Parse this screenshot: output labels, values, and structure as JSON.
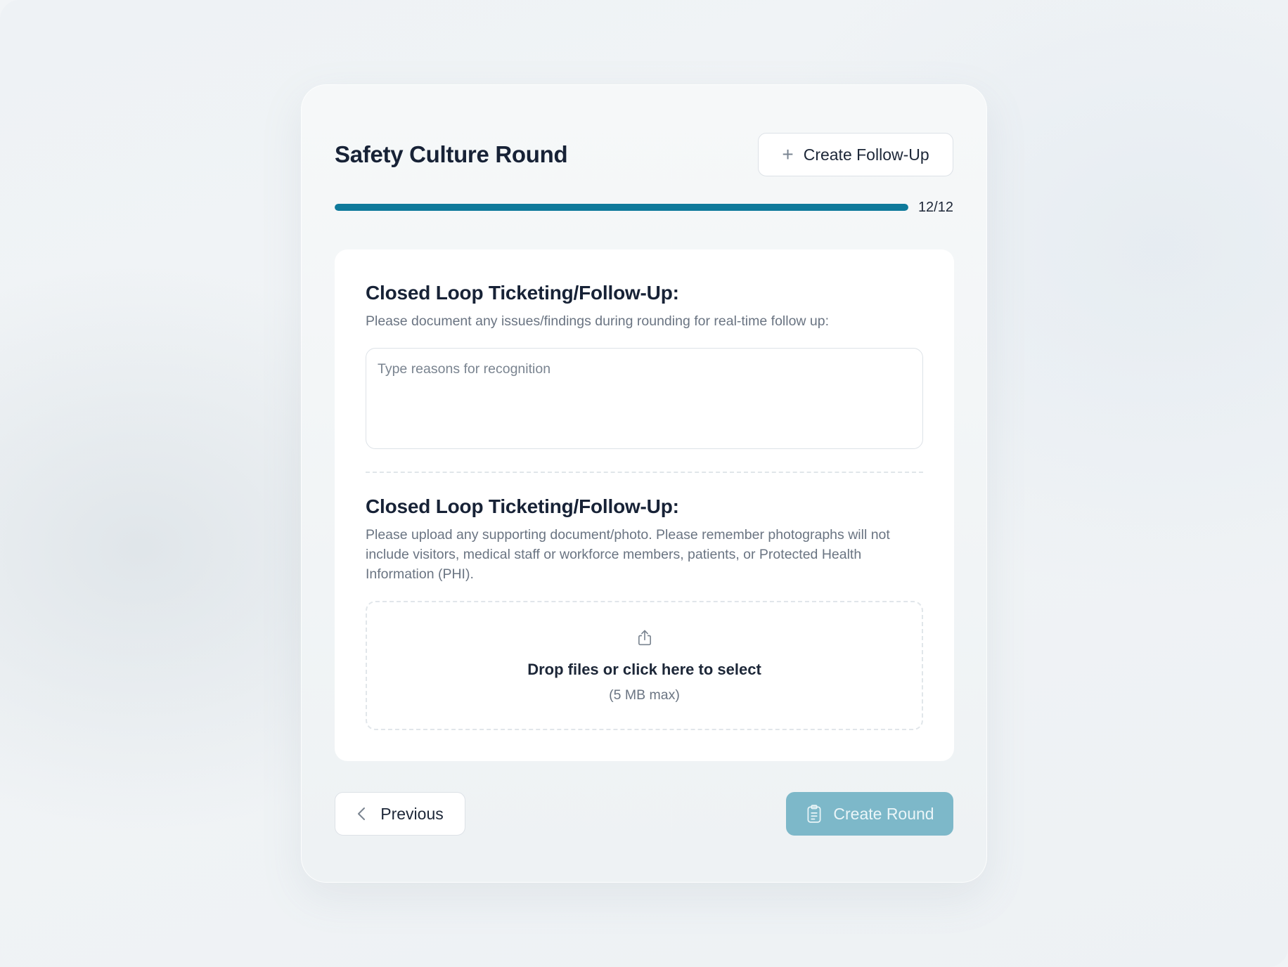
{
  "header": {
    "title": "Safety Culture Round",
    "follow_up_button": "Create Follow-Up"
  },
  "progress": {
    "current": 12,
    "total": 12,
    "fraction": 1.0,
    "label": "12/12",
    "color": "#0f7a9b"
  },
  "section_one": {
    "title": "Closed Loop Ticketing/Follow-Up:",
    "description": "Please document any issues/findings during rounding for real-time follow up:",
    "input_placeholder": "Type reasons for recognition",
    "input_value": ""
  },
  "section_two": {
    "title": "Closed Loop Ticketing/Follow-Up:",
    "description": "Please upload any supporting document/photo. Please remember photographs will not include visitors, medical staff or workforce members, patients, or Protected Health Information (PHI).",
    "dropzone_title": "Drop files or click here to select",
    "dropzone_subtitle": "(5 MB max)"
  },
  "footer": {
    "previous_button": "Previous",
    "create_button": "Create Round",
    "create_button_color": "#7db8c9"
  },
  "icons": {
    "follow_up": "plus-icon",
    "dropzone": "upload-icon",
    "previous": "chevron-left-icon",
    "create": "clipboard-icon"
  }
}
